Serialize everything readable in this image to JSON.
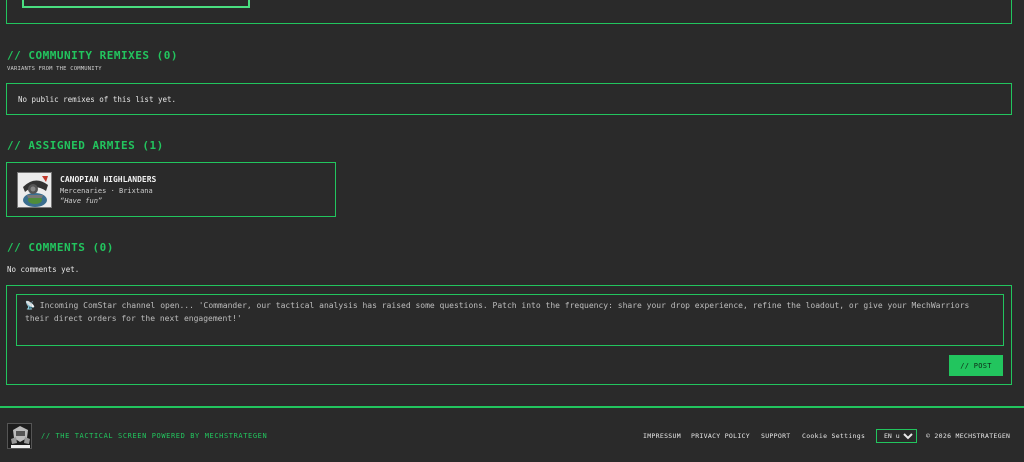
{
  "community": {
    "heading": "// COMMUNITY REMIXES (0)",
    "subheading": "VARIANTS FROM THE COMMUNITY",
    "empty_text": "No public remixes of this list yet."
  },
  "armies": {
    "heading": "// ASSIGNED ARMIES (1)",
    "items": [
      {
        "name": "CANOPIAN HIGHLANDERS",
        "subtitle": "Mercenaries · Brixtana",
        "quote": "“Have fun”"
      }
    ]
  },
  "comments": {
    "heading": "// COMMENTS (0)",
    "empty_text": "No comments yet.",
    "placeholder": "📡 Incoming ComStar channel open... 'Commander, our tactical analysis has raised some questions. Patch into the frequency: share your drop experience, refine the loadout, or give your MechWarriors their direct orders for the next engagement!'",
    "post_label": "// POST"
  },
  "footer": {
    "tagline": "// THE TACTICAL SCREEN POWERED BY MECHSTRATEGEN",
    "links": [
      "IMPRESSUM",
      "PRIVACY POLICY",
      "SUPPORT",
      "Cookie Settings"
    ],
    "language": "EN us",
    "copyright": "© 2026 MECHSTRATEGEN"
  },
  "colors": {
    "accent": "#22c55e",
    "background": "#2a2a2a"
  }
}
